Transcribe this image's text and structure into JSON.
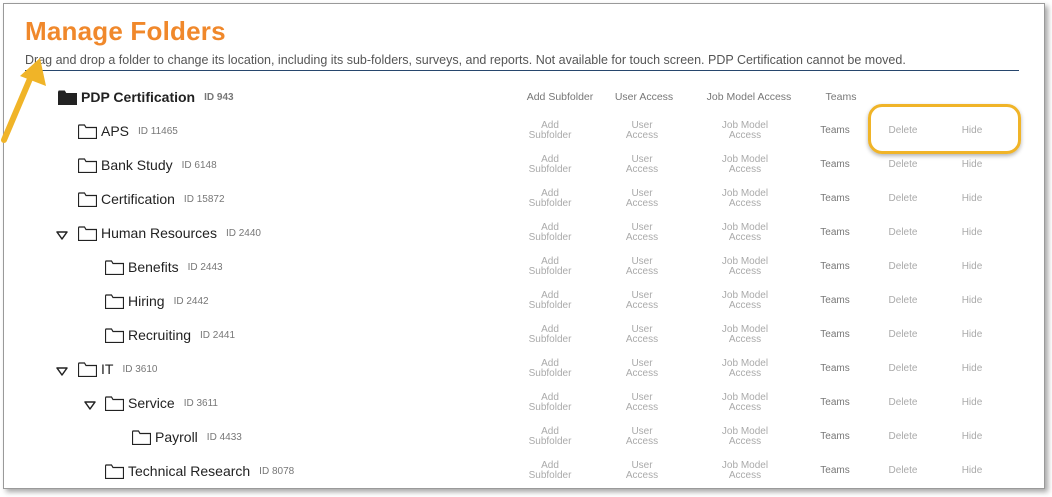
{
  "page": {
    "title": "Manage Folders",
    "subtitle": "Drag and drop a folder to change its location, including its sub-folders, surveys, and reports. Not available for touch screen. PDP Certification cannot be moved."
  },
  "header": {
    "folder_name": "PDP Certification",
    "folder_id": "ID 943",
    "add_subfolder": "Add Subfolder",
    "user_access": "User Access",
    "job_model_access": "Job Model Access",
    "teams": "Teams"
  },
  "actions": {
    "add_1": "Add",
    "add_2": "Subfolder",
    "user_1": "User",
    "user_2": "Access",
    "job_1": "Job Model",
    "job_2": "Access",
    "teams": "Teams",
    "delete": "Delete",
    "hide": "Hide"
  },
  "folders": [
    {
      "name": "APS",
      "id": "ID 11465",
      "expanded": false
    },
    {
      "name": "Bank Study",
      "id": "ID 6148",
      "expanded": false
    },
    {
      "name": "Certification",
      "id": "ID 15872",
      "expanded": false
    },
    {
      "name": "Human Resources",
      "id": "ID 2440",
      "expanded": true
    },
    {
      "name": "Benefits",
      "id": "ID 2443",
      "expanded": false
    },
    {
      "name": "Hiring",
      "id": "ID 2442",
      "expanded": false
    },
    {
      "name": "Recruiting",
      "id": "ID 2441",
      "expanded": false
    },
    {
      "name": "IT",
      "id": "ID 3610",
      "expanded": true
    },
    {
      "name": "Service",
      "id": "ID 3611",
      "expanded": true
    },
    {
      "name": "Payroll",
      "id": "ID 4433",
      "expanded": false
    },
    {
      "name": "Technical Research",
      "id": "ID 8078",
      "expanded": false
    }
  ],
  "colors": {
    "title": "#f0882b",
    "rule": "#27466d",
    "callout": "#f0b428",
    "action_text": "#aaaaaa"
  },
  "icons": {
    "folder": "folder-icon",
    "expand": "caret-down-icon",
    "pointer": "arrow-icon"
  }
}
